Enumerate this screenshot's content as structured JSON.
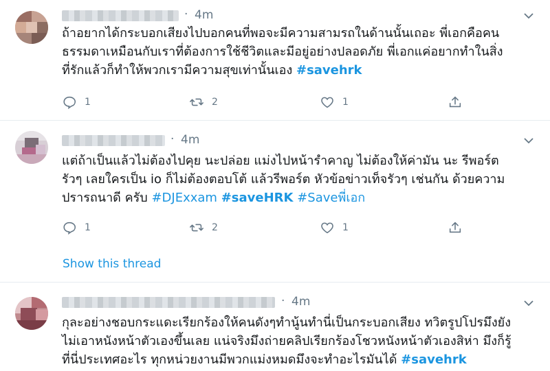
{
  "tweets": [
    {
      "time": "4m",
      "lines": [
        [
          "ถ้าอยากได้กระบอกเสียงไปบอกคนที่พอจะมีความสามรถในด้านนั้นเถอะ พี่เอกคือคน"
        ],
        [
          "ธรรมดาเหมือนกับเราที่ต้องการใช้ชีวิตและมีอยู่อย่างปลอดภัย พี่เอกแค่อยากทำในสิ่ง"
        ],
        [
          "ที่รักแล้วก็ทำให้พวกเรามีความสุขเท่านั้นเอง ",
          "#savehrk"
        ]
      ],
      "reply_count": "1",
      "retweet_count": "2",
      "like_count": "1"
    },
    {
      "time": "4m",
      "lines": [
        [
          "แต่ถ้าเป็นแล้วไม่ต้องไปคุย นะปล่อย แม่งไปหน้ารำคาญ ไม่ต้องให้ค่ามัน นะ รีพอร์ต"
        ],
        [
          "รัวๆ เลยใครเป็น io ก็ไม่ต้องตอบโต้ แล้วรีพอร์ต หัวข้อข่าวเท็จรัวๆ เช่นกัน ด้วยความ"
        ],
        [
          "ปรารถนาดี ครับ ",
          "#DJExxam",
          " ",
          "#saveHRK",
          " ",
          "#Saveพี่เอก"
        ]
      ],
      "reply_count": "1",
      "retweet_count": "2",
      "like_count": "1",
      "show_thread": "Show this thread"
    },
    {
      "time": "4m",
      "lines": [
        [
          "กุละอย่างชอบกระแดะเรียกร้องให้คนดังๆทำนู้นทำนี่เป็นกระบอกเสียง ทวิตรูปโปรมึงยัง"
        ],
        [
          "ไม่เอาหนังหน้าตัวเองขึ้นเลย แน่จริงมึงถ่ายคลิปเรียกร้องโชวหนังหน้าตัวเองสิห่า มึงก็รู้"
        ],
        [
          "ที่นี่ประเทศอะไร ทุกหน่วยงานมีพวกแม่งหมดมึงจะทำอะไรมันได้ ",
          "#savehrk"
        ]
      ]
    }
  ],
  "icons": {
    "reply": "reply-icon",
    "retweet": "retweet-icon",
    "like": "like-icon",
    "share": "share-icon",
    "more": "chevron-down-icon"
  },
  "colors": {
    "link": "#1b95e0",
    "muted": "#657786",
    "text": "#14171a",
    "divider": "#e6ecf0"
  }
}
